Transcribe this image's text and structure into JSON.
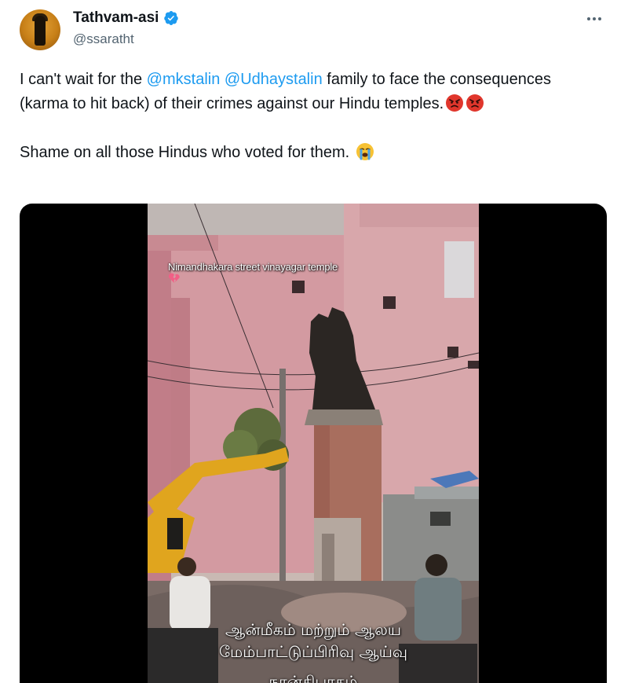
{
  "author": {
    "display_name": "Tathvam-asi",
    "handle": "@ssaratht",
    "verified": true
  },
  "tweet": {
    "line1_before": "I can't wait for the ",
    "mention1": "@mkstalin",
    "mention2": "@Udhaystalin",
    "line1_after": " family to face the consequences (karma to hit back) of their crimes against our Hindu temples.",
    "emoji_angry": "angry-face",
    "line2": "Shame on all those Hindus who voted for them.",
    "emoji_crying": "loudly-crying-face"
  },
  "video": {
    "overlay_caption": "Nimandhakara street vinayagar temple",
    "tamil_line1": "ஆன்மீகம் மற்றும் ஆலய",
    "tamil_line2": "மேம்பாட்டுப்பிரிவு ஆய்வு",
    "tamil_line3": "நான்கிபாகம்"
  },
  "colors": {
    "mention": "#1d9bf0",
    "verified": "#1d9bf0",
    "wall_pink": "#d8a7ab"
  }
}
